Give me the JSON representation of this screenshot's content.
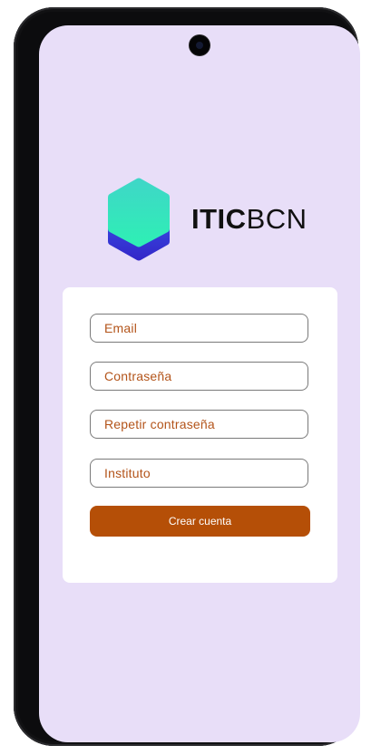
{
  "brand": {
    "name_bold": "ITIC",
    "name_light": "BCN",
    "logo_icon": "hexagon-logo-icon"
  },
  "form": {
    "email_placeholder": "Email",
    "password_placeholder": "Contraseña",
    "repeat_password_placeholder": "Repetir contraseña",
    "institute_placeholder": "Instituto",
    "submit_label": "Crear cuenta"
  },
  "colors": {
    "background": "#e8def8",
    "accent": "#b54f07",
    "placeholder_text": "#b3541a",
    "logo_gradient_top": "#3fe0c6",
    "logo_gradient_bottom": "#3b3fe0"
  }
}
